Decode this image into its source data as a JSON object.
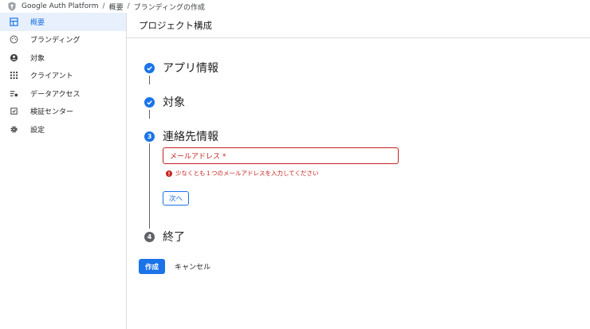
{
  "breadcrumb": {
    "items": [
      "Google Auth Platform",
      "概要",
      "ブランディングの作成"
    ],
    "separator": "/"
  },
  "sidebar": {
    "items": [
      {
        "label": "概要",
        "icon": "dashboard-icon",
        "active": true
      },
      {
        "label": "ブランディング",
        "icon": "palette-icon",
        "active": false
      },
      {
        "label": "対象",
        "icon": "account-icon",
        "active": false
      },
      {
        "label": "クライアント",
        "icon": "grid-icon",
        "active": false
      },
      {
        "label": "データアクセス",
        "icon": "data-access-icon",
        "active": false
      },
      {
        "label": "検証センター",
        "icon": "verification-icon",
        "active": false
      },
      {
        "label": "設定",
        "icon": "gear-icon",
        "active": false
      }
    ]
  },
  "main": {
    "title": "プロジェクト構成",
    "steps": [
      {
        "number": "",
        "title": "アプリ情報",
        "status": "done"
      },
      {
        "number": "",
        "title": "対象",
        "status": "done"
      },
      {
        "number": "3",
        "title": "連絡先情報",
        "status": "current"
      },
      {
        "number": "4",
        "title": "終了",
        "status": "todo"
      }
    ],
    "email_field": {
      "placeholder": "メールアドレス *",
      "value": ""
    },
    "error_message": "少なくとも１つのメールアドレスを入力してください",
    "next_label": "次へ",
    "create_label": "作成",
    "cancel_label": "キャンセル"
  },
  "colors": {
    "accent": "#1a73e8",
    "error": "#c5221f",
    "active_bg": "#e8f0fe"
  }
}
